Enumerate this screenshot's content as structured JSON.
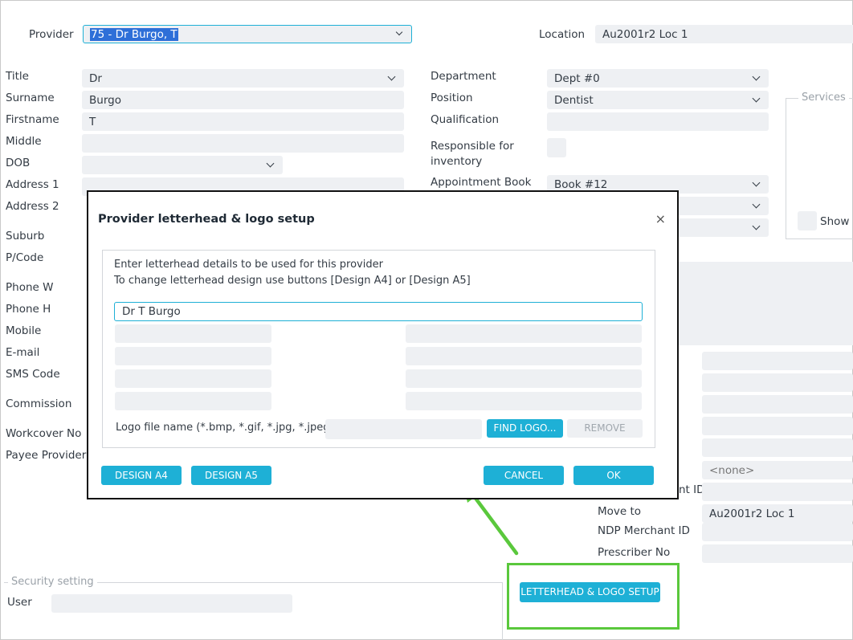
{
  "header": {
    "provider_label": "Provider",
    "provider_value": "75 - Dr Burgo, T",
    "location_label": "Location",
    "location_value": "Au2001r2 Loc 1"
  },
  "left_form": {
    "title_label": "Title",
    "title_value": "Dr",
    "surname_label": "Surname",
    "surname_value": "Burgo",
    "firstname_label": "Firstname",
    "firstname_value": "T",
    "middle_label": "Middle",
    "dob_label": "DOB",
    "address1_label": "Address 1",
    "address2_label": "Address 2",
    "suburb_label": "Suburb",
    "pcode_label": "P/Code",
    "phonew_label": "Phone W",
    "phoneh_label": "Phone H",
    "mobile_label": "Mobile",
    "email_label": "E-mail",
    "sms_label": "SMS Code",
    "commission_label": "Commission",
    "workcover_label": "Workcover No",
    "payee_label": "Payee Provider"
  },
  "mid_form": {
    "department_label": "Department",
    "department_value": "Dept #0",
    "position_label": "Position",
    "position_value": "Dentist",
    "qualification_label": "Qualification",
    "responsible_label": "Responsible for inventory",
    "appointment_label": "Appointment Book",
    "appointment_value": "Book #12"
  },
  "services": {
    "title": "Services",
    "show_label": "Show a"
  },
  "right_lower": {
    "none_value": "<none>",
    "merchant_label_partial": "nt ID",
    "move_to_label": "Move to",
    "move_to_value": "Au2001r2 Loc 1",
    "ndp_label": "NDP Merchant ID",
    "prescriber_label": "Prescriber No"
  },
  "security": {
    "title": "Security setting",
    "user_label": "User"
  },
  "letterhead_button": "LETTERHEAD & LOGO SETUP",
  "dialog": {
    "title": "Provider letterhead & logo setup",
    "close": "×",
    "instruction_line1": "Enter letterhead details to be used for this provider",
    "instruction_line2": "To change letterhead design use buttons [Design A4] or [Design A5]",
    "line1_value": "Dr T Burgo",
    "logo_label": "Logo file name (*.bmp, *.gif, *.jpg, *.jpeg)",
    "find_logo": "FIND LOGO...",
    "remove": "REMOVE",
    "design_a4": "DESIGN A4",
    "design_a5": "DESIGN A5",
    "cancel": "CANCEL",
    "ok": "OK"
  },
  "colors": {
    "accent": "#1eb0d6",
    "annotation": "#5ac83c",
    "field_bg": "#eef0f3"
  }
}
